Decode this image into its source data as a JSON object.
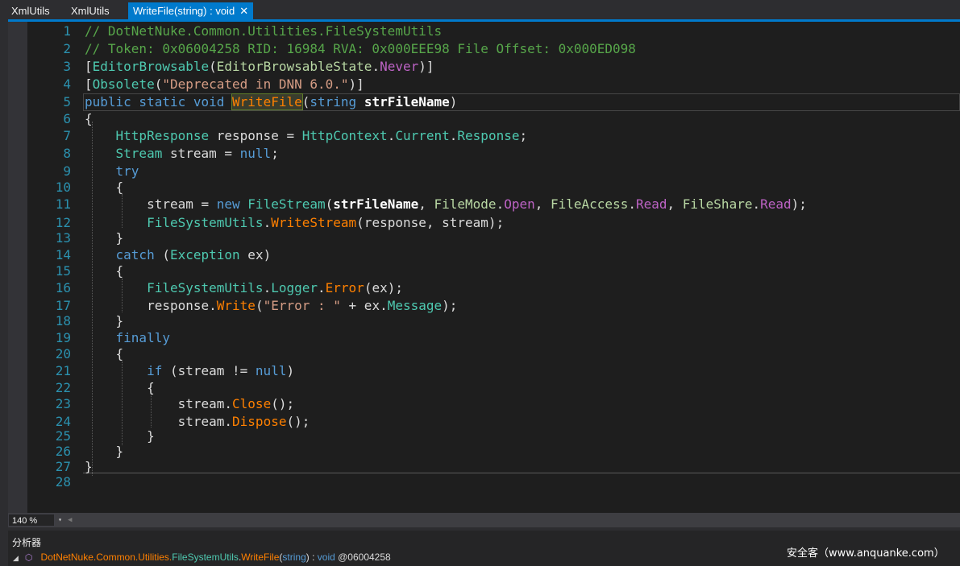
{
  "tabs": [
    {
      "label": "XmlUtils",
      "active": false
    },
    {
      "label": "XmlUtils",
      "active": false
    },
    {
      "label": "WriteFile(string) : void",
      "active": true,
      "close": "✕"
    }
  ],
  "editor": {
    "line_numbers": [
      "1",
      "2",
      "3",
      "4",
      "5",
      "6",
      "7",
      "8",
      "9",
      "10",
      "11",
      "12",
      "13",
      "14",
      "15",
      "16",
      "17",
      "18",
      "19",
      "20",
      "21",
      "22",
      "23",
      "24",
      "25",
      "26",
      "27",
      "28"
    ],
    "lines": [
      [
        {
          "t": "// DotNetNuke.Common.Utilities.FileSystemUtils",
          "c": "cm"
        }
      ],
      [
        {
          "t": "// Token: 0x06004258 RID: 16984 RVA: 0x000EEE98 File Offset: 0x000ED098",
          "c": "cm"
        }
      ],
      [
        {
          "t": "[",
          "c": ""
        },
        {
          "t": "EditorBrowsable",
          "c": "ty"
        },
        {
          "t": "(",
          "c": ""
        },
        {
          "t": "EditorBrowsableState",
          "c": "en"
        },
        {
          "t": ".",
          "c": ""
        },
        {
          "t": "Never",
          "c": "ev"
        },
        {
          "t": ")]",
          "c": ""
        }
      ],
      [
        {
          "t": "[",
          "c": ""
        },
        {
          "t": "Obsolete",
          "c": "ty"
        },
        {
          "t": "(",
          "c": ""
        },
        {
          "t": "\"Deprecated in DNN 6.0.\"",
          "c": "st"
        },
        {
          "t": ")]",
          "c": ""
        }
      ],
      [
        {
          "t": "public static void ",
          "c": "kw"
        },
        {
          "t": "WriteFile",
          "c": "hl"
        },
        {
          "t": "(",
          "c": ""
        },
        {
          "t": "string ",
          "c": "kw"
        },
        {
          "t": "strFileName",
          "c": "pa"
        },
        {
          "t": ")",
          "c": ""
        }
      ],
      [
        {
          "t": "{",
          "c": ""
        }
      ],
      [
        {
          "t": "    ",
          "c": ""
        },
        {
          "t": "HttpResponse",
          "c": "ty"
        },
        {
          "t": " response = ",
          "c": ""
        },
        {
          "t": "HttpContext",
          "c": "ty"
        },
        {
          "t": ".",
          "c": ""
        },
        {
          "t": "Current",
          "c": "pr"
        },
        {
          "t": ".",
          "c": ""
        },
        {
          "t": "Response",
          "c": "pr"
        },
        {
          "t": ";",
          "c": ""
        }
      ],
      [
        {
          "t": "    ",
          "c": ""
        },
        {
          "t": "Stream",
          "c": "ty"
        },
        {
          "t": " stream = ",
          "c": ""
        },
        {
          "t": "null",
          "c": "kw"
        },
        {
          "t": ";",
          "c": ""
        }
      ],
      [
        {
          "t": "    ",
          "c": ""
        },
        {
          "t": "try",
          "c": "kw"
        }
      ],
      [
        {
          "t": "    {",
          "c": ""
        }
      ],
      [
        {
          "t": "        stream = ",
          "c": ""
        },
        {
          "t": "new ",
          "c": "kw"
        },
        {
          "t": "FileStream",
          "c": "ty"
        },
        {
          "t": "(",
          "c": ""
        },
        {
          "t": "strFileName",
          "c": "pa"
        },
        {
          "t": ", ",
          "c": ""
        },
        {
          "t": "FileMode",
          "c": "en"
        },
        {
          "t": ".",
          "c": ""
        },
        {
          "t": "Open",
          "c": "ev"
        },
        {
          "t": ", ",
          "c": ""
        },
        {
          "t": "FileAccess",
          "c": "en"
        },
        {
          "t": ".",
          "c": ""
        },
        {
          "t": "Read",
          "c": "ev"
        },
        {
          "t": ", ",
          "c": ""
        },
        {
          "t": "FileShare",
          "c": "en"
        },
        {
          "t": ".",
          "c": ""
        },
        {
          "t": "Read",
          "c": "ev"
        },
        {
          "t": ");",
          "c": ""
        }
      ],
      [
        {
          "t": "        ",
          "c": ""
        },
        {
          "t": "FileSystemUtils",
          "c": "ty"
        },
        {
          "t": ".",
          "c": ""
        },
        {
          "t": "WriteStream",
          "c": "mt"
        },
        {
          "t": "(response, stream);",
          "c": ""
        }
      ],
      [
        {
          "t": "    }",
          "c": ""
        }
      ],
      [
        {
          "t": "    ",
          "c": ""
        },
        {
          "t": "catch",
          "c": "kw"
        },
        {
          "t": " (",
          "c": ""
        },
        {
          "t": "Exception",
          "c": "ty"
        },
        {
          "t": " ex)",
          "c": ""
        }
      ],
      [
        {
          "t": "    {",
          "c": ""
        }
      ],
      [
        {
          "t": "        ",
          "c": ""
        },
        {
          "t": "FileSystemUtils",
          "c": "ty"
        },
        {
          "t": ".",
          "c": ""
        },
        {
          "t": "Logger",
          "c": "pr"
        },
        {
          "t": ".",
          "c": ""
        },
        {
          "t": "Error",
          "c": "mt"
        },
        {
          "t": "(ex);",
          "c": ""
        }
      ],
      [
        {
          "t": "        response.",
          "c": ""
        },
        {
          "t": "Write",
          "c": "mt"
        },
        {
          "t": "(",
          "c": ""
        },
        {
          "t": "\"Error : \"",
          "c": "st"
        },
        {
          "t": " + ex.",
          "c": ""
        },
        {
          "t": "Message",
          "c": "pr"
        },
        {
          "t": ");",
          "c": ""
        }
      ],
      [
        {
          "t": "    }",
          "c": ""
        }
      ],
      [
        {
          "t": "    ",
          "c": ""
        },
        {
          "t": "finally",
          "c": "kw"
        }
      ],
      [
        {
          "t": "    {",
          "c": ""
        }
      ],
      [
        {
          "t": "        ",
          "c": ""
        },
        {
          "t": "if",
          "c": "kw"
        },
        {
          "t": " (stream != ",
          "c": ""
        },
        {
          "t": "null",
          "c": "kw"
        },
        {
          "t": ")",
          "c": ""
        }
      ],
      [
        {
          "t": "        {",
          "c": ""
        }
      ],
      [
        {
          "t": "            stream.",
          "c": ""
        },
        {
          "t": "Close",
          "c": "mt"
        },
        {
          "t": "();",
          "c": ""
        }
      ],
      [
        {
          "t": "            stream.",
          "c": ""
        },
        {
          "t": "Dispose",
          "c": "mt"
        },
        {
          "t": "();",
          "c": ""
        }
      ],
      [
        {
          "t": "        }",
          "c": ""
        }
      ],
      [
        {
          "t": "    }",
          "c": ""
        }
      ],
      [
        {
          "t": "}",
          "c": ""
        }
      ],
      []
    ]
  },
  "zoom": {
    "value": "140 %",
    "dropdown": "▾"
  },
  "analyzer": {
    "title": "分析器",
    "expand_icon": "◢",
    "item_icon": "⬡",
    "item": {
      "ns": "DotNetNuke.Common.Utilities.",
      "cls": "FileSystemUtils",
      "dot": ".",
      "meth": "WriteFile",
      "args_open": "(",
      "arg": "string",
      "args_close": ")",
      "sep": " : ",
      "ret": "void",
      "token": " @06004258"
    }
  },
  "watermark": "安全客（www.anquanke.com）"
}
